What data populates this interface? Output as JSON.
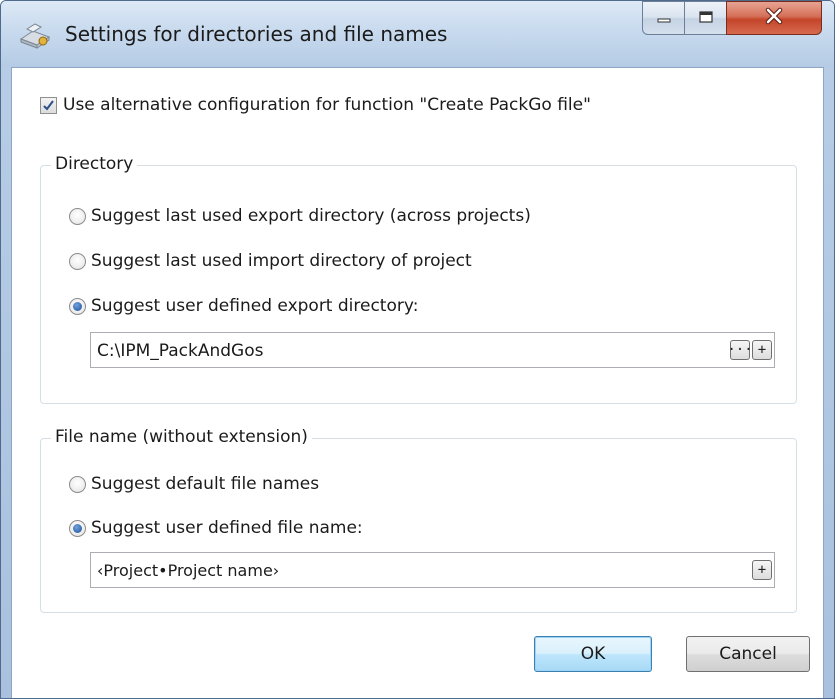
{
  "window": {
    "title": "Settings for directories and file names",
    "app_icon": "settings-package-icon"
  },
  "caption_buttons": {
    "minimize_icon": "minimize-icon",
    "maximize_icon": "maximize-icon",
    "close_icon": "close-icon",
    "close_color": "#c4452a"
  },
  "alt_config": {
    "label": "Use alternative configuration for function \"Create PackGo file\"",
    "checked": true
  },
  "directory_group": {
    "title": "Directory",
    "options": [
      {
        "label": "Suggest last used export directory (across projects)",
        "selected": false
      },
      {
        "label": "Suggest last used import directory of project",
        "selected": false
      },
      {
        "label": "Suggest user defined export directory:",
        "selected": true
      }
    ],
    "path_value": "C:\\IPM_PackAndGos",
    "browse_label": "···",
    "add_label": "+"
  },
  "filename_group": {
    "title": "File name (without extension)",
    "options": [
      {
        "label": "Suggest default file names",
        "selected": false
      },
      {
        "label": "Suggest user defined file name:",
        "selected": true
      }
    ],
    "name_value": "‹Project•Project name›",
    "add_label": "+"
  },
  "footer": {
    "ok_label": "OK",
    "cancel_label": "Cancel"
  }
}
